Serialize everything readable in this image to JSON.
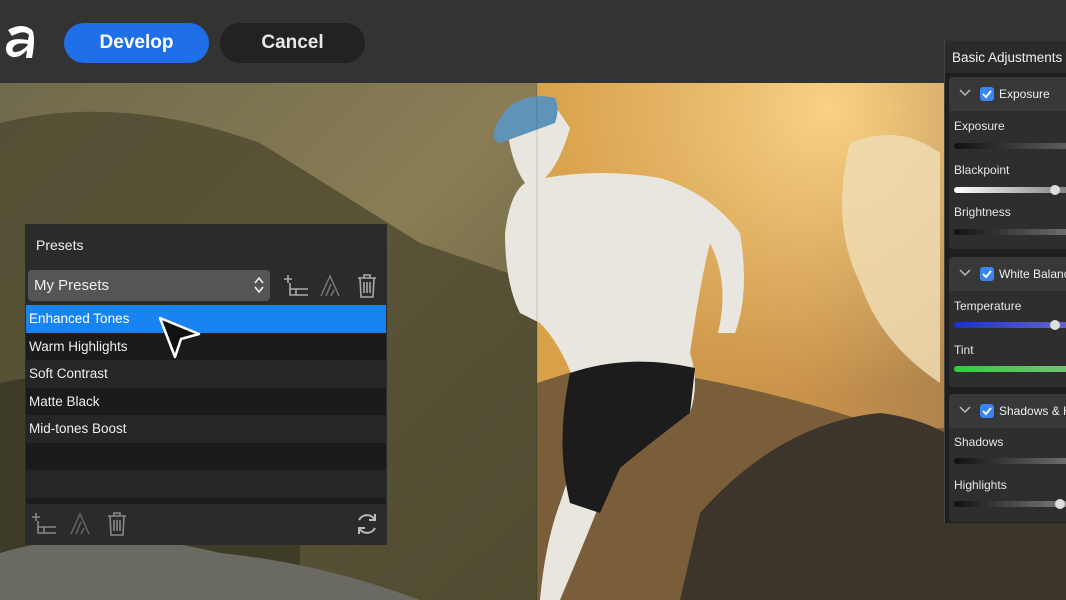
{
  "toolbar": {
    "develop_label": "Develop",
    "cancel_label": "Cancel",
    "accent": "#1f6fe8"
  },
  "presets": {
    "title": "Presets",
    "selected_group": "My Presets",
    "items": [
      {
        "label": "Enhanced Tones",
        "selected": true
      },
      {
        "label": "Warm Highlights",
        "selected": false
      },
      {
        "label": "Soft Contrast",
        "selected": false
      },
      {
        "label": "Matte Black",
        "selected": false
      },
      {
        "label": "Mid-tones Boost",
        "selected": false
      }
    ],
    "selection_color": "#1a83f2"
  },
  "adjustments": {
    "title": "Basic Adjustments",
    "sections": [
      {
        "name": "Exposure",
        "enabled": true,
        "sliders": [
          {
            "label": "Exposure",
            "value": 0.5
          },
          {
            "label": "Blackpoint",
            "value": 0.82
          },
          {
            "label": "Brightness",
            "value": 0.5
          }
        ]
      },
      {
        "name": "White Balance",
        "enabled": true,
        "sliders": [
          {
            "label": "Temperature",
            "value": 0.82
          },
          {
            "label": "Tint",
            "value": 0.5
          }
        ]
      },
      {
        "name": "Shadows & Highlights",
        "enabled": true,
        "sliders": [
          {
            "label": "Shadows",
            "value": 0.5
          },
          {
            "label": "Highlights",
            "value": 0.85
          }
        ]
      }
    ]
  }
}
